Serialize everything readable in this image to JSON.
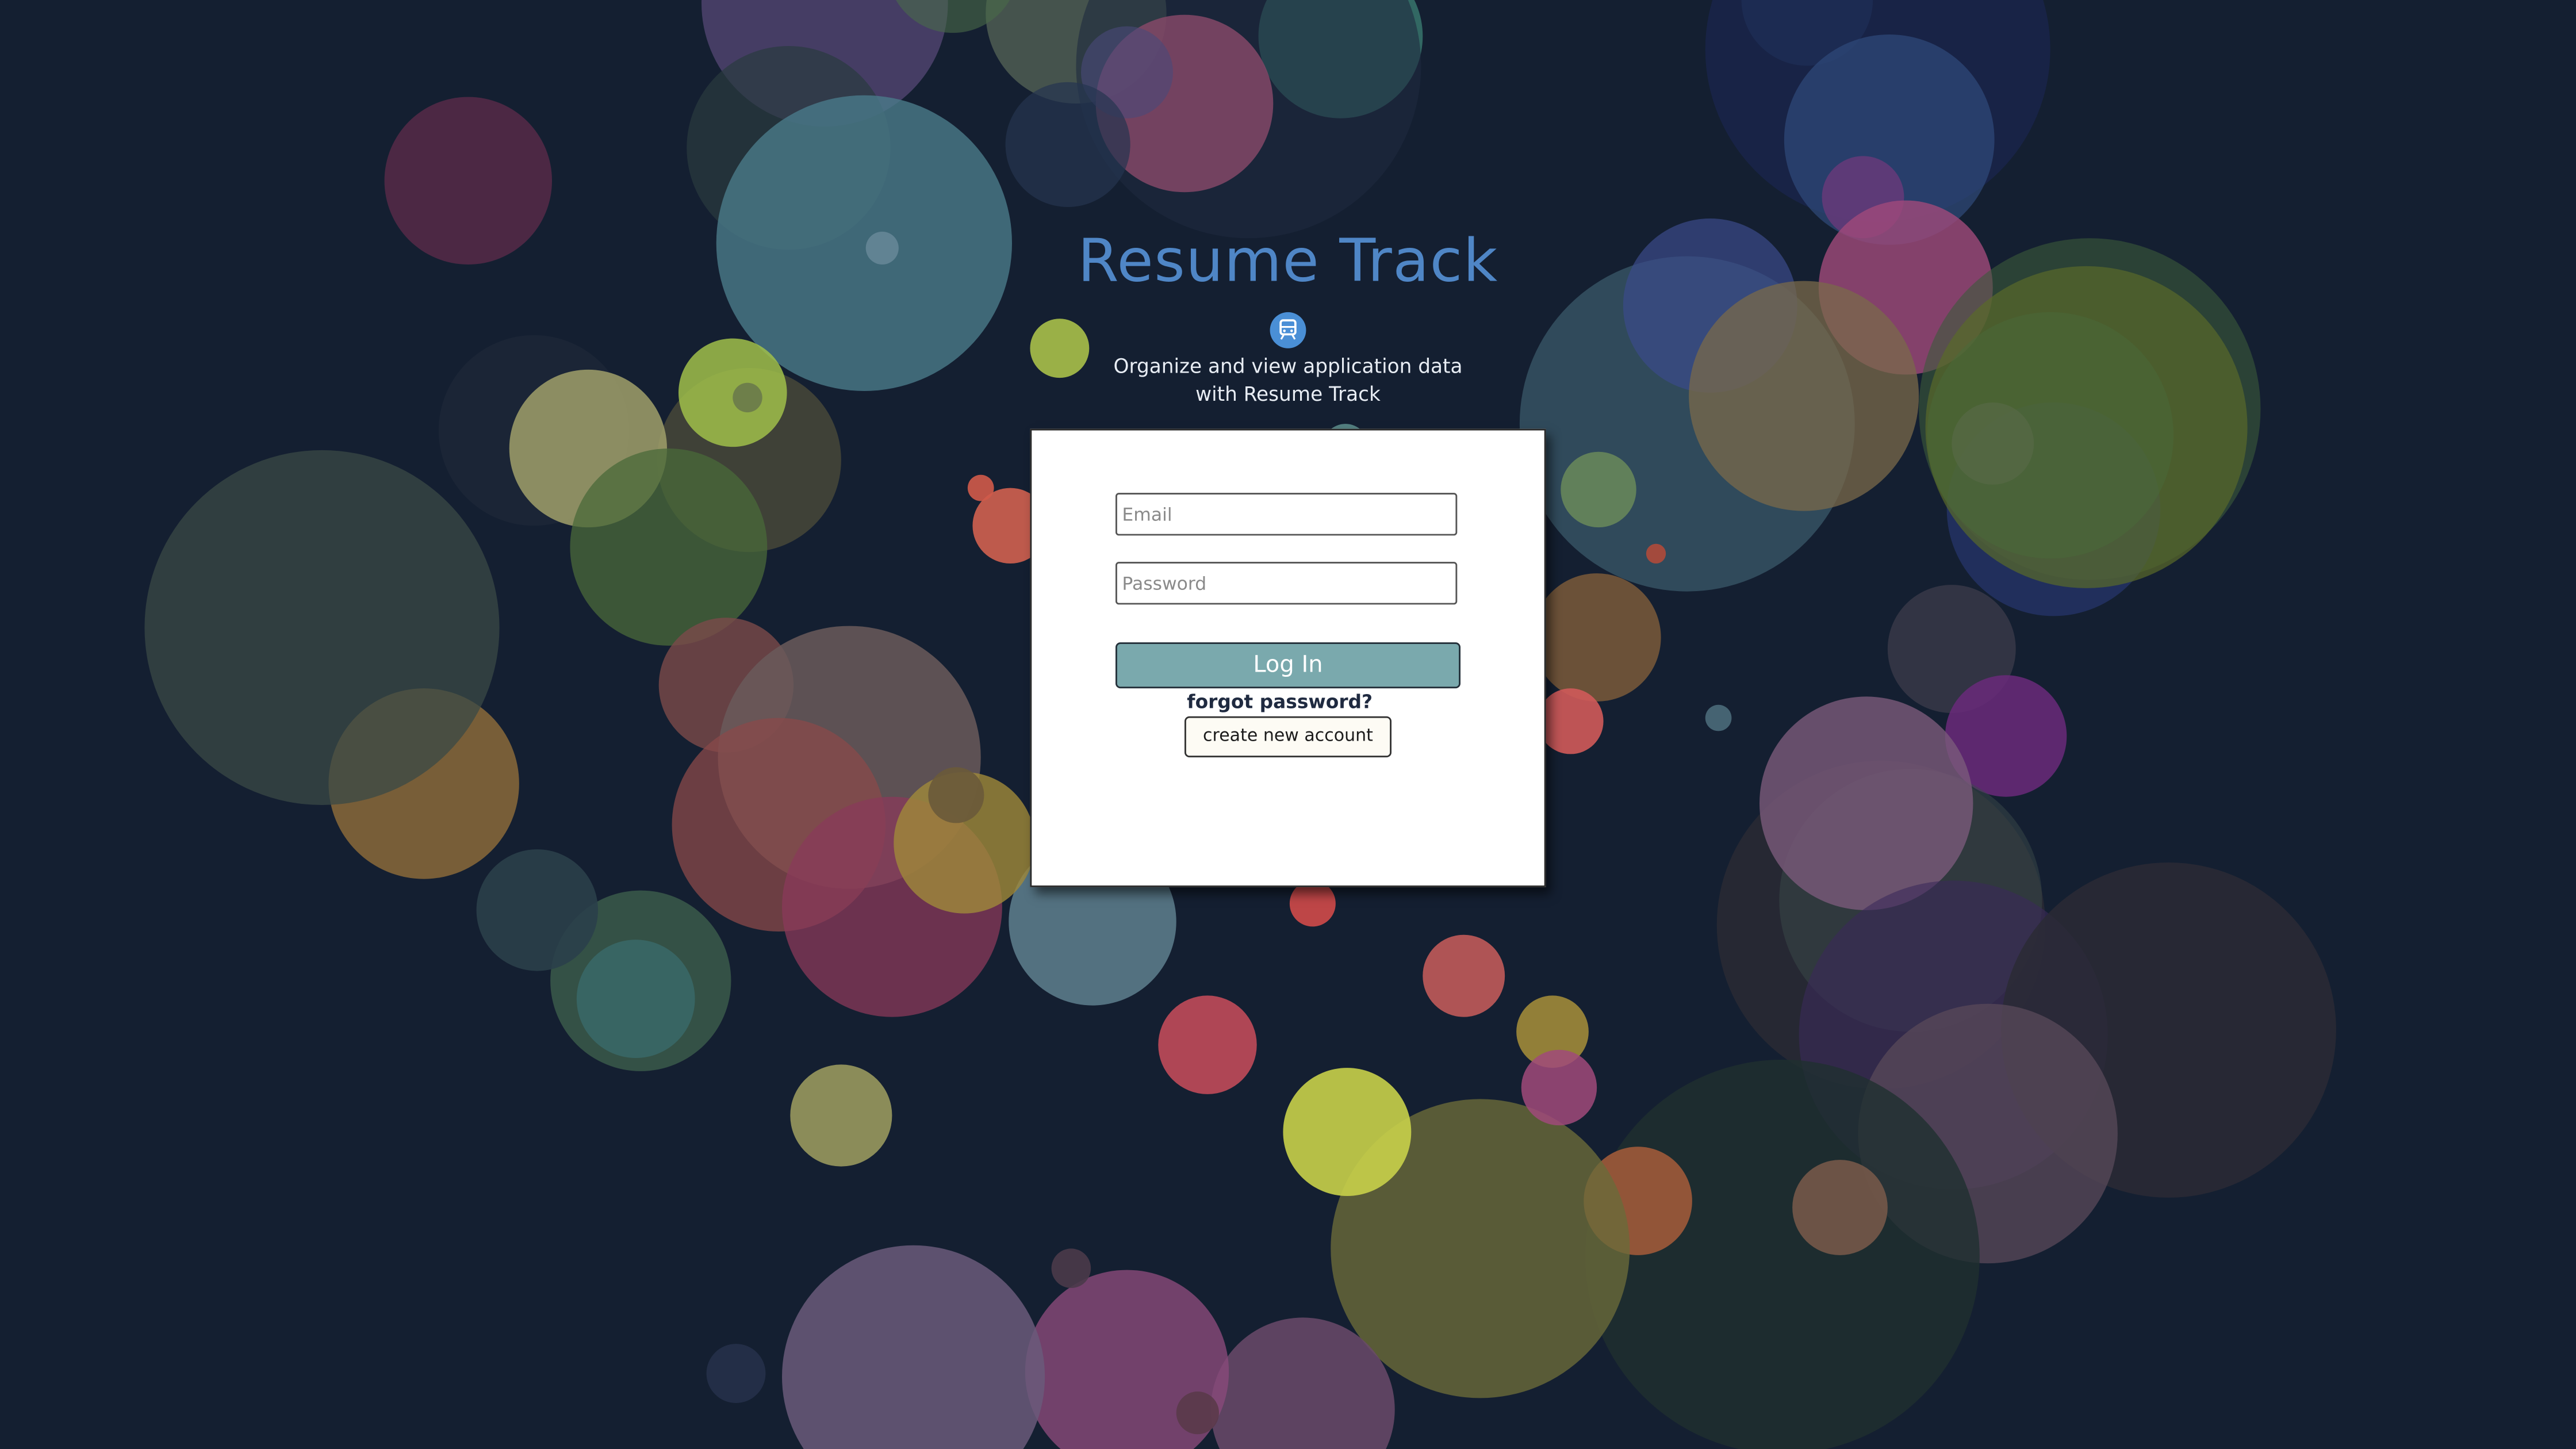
{
  "app": {
    "title": "Resume Track",
    "tagline_line1": "Organize and view application data",
    "tagline_line2": "with Resume Track",
    "logo_icon": "train-icon"
  },
  "login_form": {
    "email_placeholder": "Email",
    "email_value": "",
    "password_placeholder": "Password",
    "password_value": "",
    "login_label": "Log In",
    "forgot_label": "forgot password?",
    "create_label": "create new account"
  },
  "colors": {
    "background": "#141f31",
    "title": "#4f86c6",
    "login_button": "#7aa9ad",
    "logo": "#4a8fd6"
  }
}
